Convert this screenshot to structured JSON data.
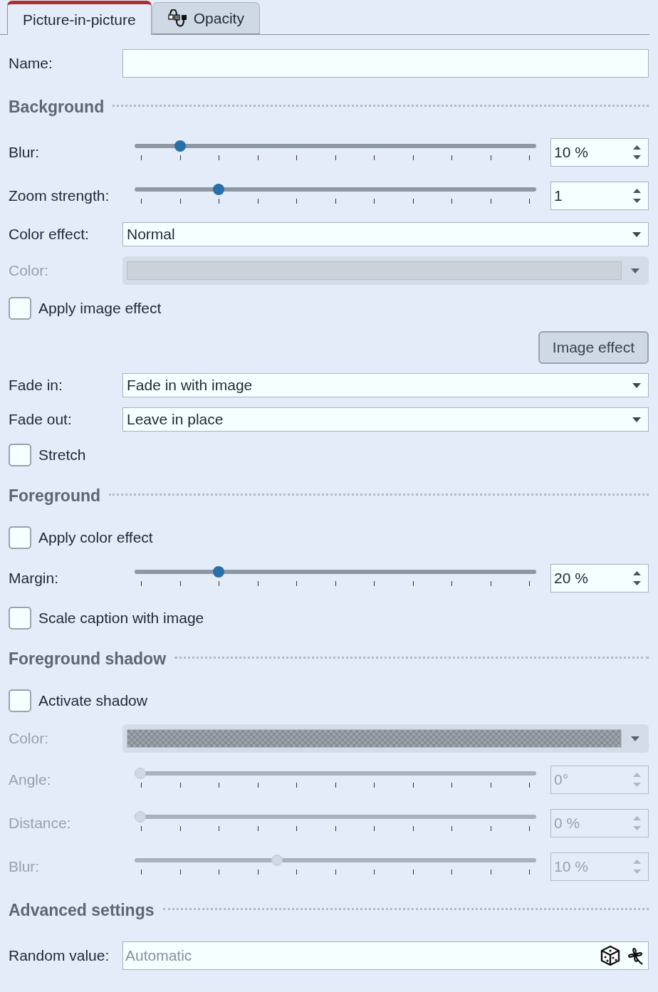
{
  "tabs": [
    {
      "label": "Picture-in-picture",
      "selected": true,
      "icon": false
    },
    {
      "label": "Opacity",
      "selected": false,
      "icon": true
    }
  ],
  "rows": [
    {
      "kind": "field",
      "label": "Name:",
      "value": ""
    },
    {
      "kind": "section",
      "title": "Background"
    },
    {
      "kind": "slider",
      "label": "Blur:",
      "level": 0.102,
      "reading": "10 %",
      "disabled": false
    },
    {
      "kind": "slider",
      "label": "Zoom strength:",
      "level": 0.2,
      "reading": "1",
      "disabled": false
    },
    {
      "kind": "dropdown",
      "label": "Color effect:",
      "value": "Normal"
    },
    {
      "kind": "color",
      "label": "Color:",
      "disabled": true,
      "transparent": false
    },
    {
      "kind": "checkbox",
      "label": "Apply image effect",
      "checked": false
    },
    {
      "kind": "button",
      "label": "Image effect"
    },
    {
      "kind": "dropdown",
      "label": "Fade in:",
      "value": "Fade in with image"
    },
    {
      "kind": "dropdown",
      "label": "Fade out:",
      "value": "Leave in place"
    },
    {
      "kind": "checkbox",
      "label": "Stretch",
      "checked": false
    },
    {
      "kind": "section",
      "title": "Foreground"
    },
    {
      "kind": "checkbox",
      "label": "Apply color effect",
      "checked": false
    },
    {
      "kind": "slider",
      "label": "Margin:",
      "level": 0.2,
      "reading": "20 %",
      "disabled": false
    },
    {
      "kind": "checkbox",
      "label": "Scale caption with image",
      "checked": false
    },
    {
      "kind": "section",
      "title": "Foreground shadow"
    },
    {
      "kind": "checkbox",
      "label": "Activate shadow",
      "checked": false
    },
    {
      "kind": "color",
      "label": "Color:",
      "disabled": true,
      "transparent": true
    },
    {
      "kind": "slider",
      "label": "Angle:",
      "level": 0,
      "reading": "0°",
      "disabled": true
    },
    {
      "kind": "slider",
      "label": "Distance:",
      "level": 0,
      "reading": "0 %",
      "disabled": true
    },
    {
      "kind": "slider",
      "label": "Blur:",
      "level": 0.35,
      "reading": "10 %",
      "disabled": true
    },
    {
      "kind": "section",
      "title": "Advanced settings"
    },
    {
      "kind": "random",
      "label": "Random value:",
      "placeholder": "Automatic"
    }
  ]
}
